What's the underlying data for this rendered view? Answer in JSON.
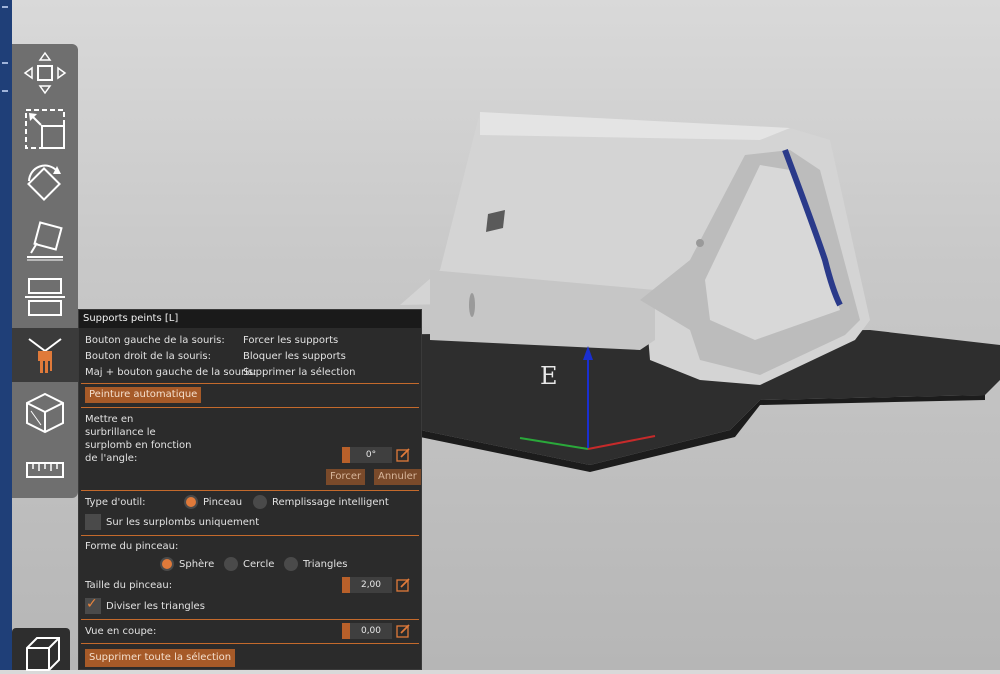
{
  "panel": {
    "title": "Supports peints [L]",
    "mouse": [
      {
        "key": "Bouton gauche de la souris:",
        "action": "Forcer les supports"
      },
      {
        "key": "Bouton droit de la souris:",
        "action": "Bloquer les supports"
      },
      {
        "key": "Maj + bouton gauche de la souris:",
        "action": "Supprimer la sélection"
      }
    ],
    "auto_paint": "Peinture automatique",
    "angle_label": [
      "Mettre en",
      "surbrillance le",
      "surplomb en fonction",
      "de l'angle:"
    ],
    "angle_value": "0°",
    "force_button": "Forcer",
    "cancel_button": "Annuler",
    "tool_type_label": "Type d'outil:",
    "tool_brush": "Pinceau",
    "tool_smart_fill": "Remplissage intelligent",
    "overhangs_only": "Sur les surplombs uniquement",
    "brush_shape_label": "Forme du pinceau:",
    "shape_sphere": "Sphère",
    "shape_circle": "Cercle",
    "shape_triangles": "Triangles",
    "brush_size_label": "Taille du pinceau:",
    "brush_size_value": "2,00",
    "split_triangles": "Diviser les triangles",
    "cut_view_label": "Vue en coupe:",
    "cut_view_value": "0,00",
    "clear_all": "Supprimer toute la sélection"
  },
  "colors": {
    "accent": "#e8843c",
    "panel_bg": "#2b2b2b",
    "toolbar_bg": "#6f6f6f"
  },
  "icons": [
    "move-icon",
    "scale-icon",
    "rotate-icon",
    "place-on-face-icon",
    "cut-icon",
    "support-paint-icon",
    "seam-paint-icon",
    "measure-icon",
    "cube-icon"
  ]
}
